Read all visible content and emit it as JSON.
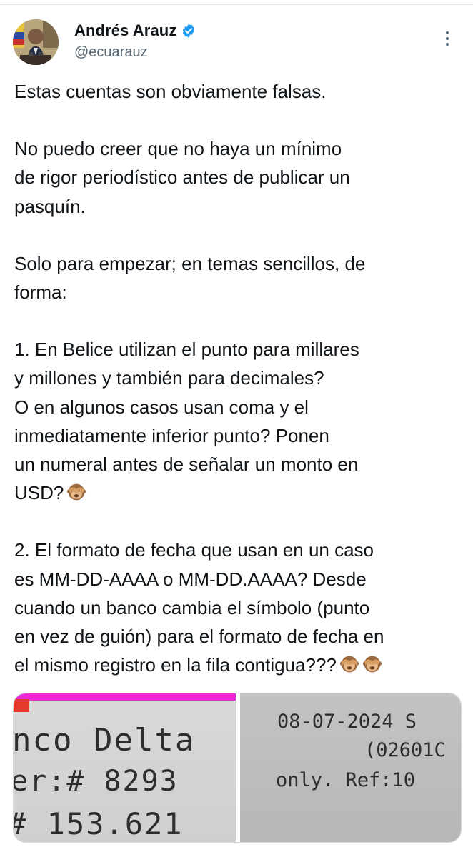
{
  "author": {
    "display_name": "Andrés Arauz",
    "handle": "@ecuarauz",
    "verified": true,
    "verified_color": "#1d9bf0"
  },
  "tweet": {
    "paragraphs": [
      "Estas cuentas son obviamente falsas.",
      "No puedo creer que no haya un mínimo\nde rigor periodístico antes de publicar un\npasquín.",
      "Solo para empezar; en temas sencillos, de\nforma:",
      "1. En Belice utilizan el punto para millares\ny millones y también para decimales?\nO en algunos casos usan coma y el\ninmediatamente inferior punto? Ponen\nun numeral antes de señalar un monto en\nUSD?",
      "2. El formato de fecha que usan en un caso\nes MM-DD-AAAA o MM-DD.AAAA? Desde\ncuando un banco cambia el símbolo (punto\nen vez de guión) para el formato de fecha en\nel mismo registro en la fila contigua???"
    ],
    "emoji_names": [
      "see-no-evil-monkey-icon"
    ]
  },
  "media": {
    "left": {
      "line1": "nco Delta",
      "line2": "er:# 8293",
      "line3": "# 153.621"
    },
    "right": {
      "line1": "08-07-2024 S",
      "line2": "(02601C",
      "line3": "only. Ref:10"
    }
  }
}
